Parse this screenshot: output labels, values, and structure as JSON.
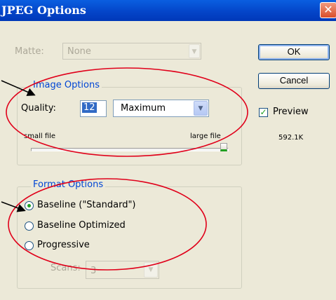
{
  "window": {
    "title": "JPEG Options",
    "close_glyph": "✕"
  },
  "matte": {
    "label": "Matte:",
    "value": "None"
  },
  "image_options": {
    "legend": "Image Options",
    "quality_label": "Quality:",
    "quality_value": "12",
    "quality_preset": "Maximum",
    "small_file": "small file",
    "large_file": "large file",
    "slider_level": 1.0
  },
  "format_options": {
    "legend": "Format Options",
    "options": [
      {
        "label": "Baseline (\"Standard\")",
        "selected": true
      },
      {
        "label": "Baseline Optimized",
        "selected": false
      },
      {
        "label": "Progressive",
        "selected": false
      }
    ],
    "scans_label": "Scans:",
    "scans_value": "3"
  },
  "buttons": {
    "ok": "OK",
    "cancel": "Cancel"
  },
  "preview": {
    "label": "Preview",
    "checked": true,
    "size": "592.1K"
  },
  "colors": {
    "titlebar": "#0445c9",
    "annotation": "#e0001a",
    "legend_text": "#0046d5"
  }
}
